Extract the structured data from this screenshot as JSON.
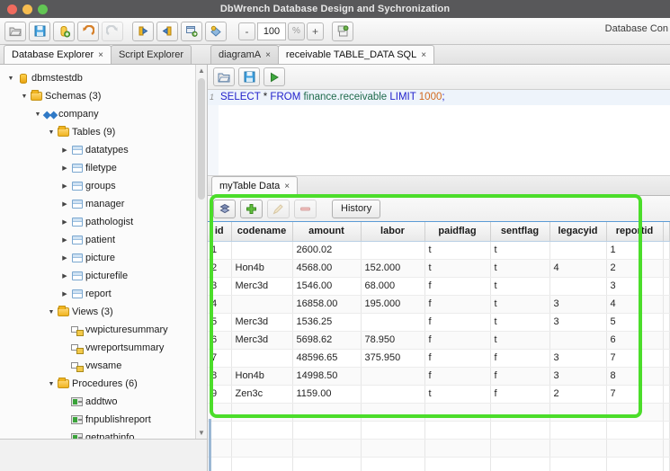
{
  "window": {
    "title": "DbWrench Database Design and Sychronization",
    "traffic_lights": [
      "close",
      "minimize",
      "maximize"
    ]
  },
  "toolbar": {
    "buttons": [
      {
        "name": "open-icon",
        "label": "Open"
      },
      {
        "name": "save-icon",
        "label": "Save"
      },
      {
        "name": "database-icon",
        "label": "New Database"
      },
      {
        "name": "undo-icon",
        "label": "Undo"
      },
      {
        "name": "redo-icon",
        "label": "Redo"
      },
      {
        "name": "forward-engineer-icon",
        "label": "Forward Engineer"
      },
      {
        "name": "reverse-engineer-icon",
        "label": "Reverse Engineer"
      },
      {
        "name": "compare-icon",
        "label": "Compare"
      },
      {
        "name": "sync-icon",
        "label": "Synchronize"
      }
    ],
    "zoom_minus": "-",
    "zoom_value": "100",
    "zoom_percent": "%",
    "zoom_plus": "+",
    "new_doc_label": "New Document",
    "database_connection_label": "Database Con"
  },
  "left_panel": {
    "tabs": [
      {
        "label": "Database Explorer",
        "close": "×",
        "active": true
      },
      {
        "label": "Script Explorer",
        "close": "",
        "active": false
      }
    ],
    "tree": [
      {
        "label": "dbmstestdb",
        "indent": 0,
        "arrow": "down",
        "icon": "database-icon"
      },
      {
        "label": "Schemas (3)",
        "indent": 1,
        "arrow": "down",
        "icon": "folder-icon"
      },
      {
        "label": "company",
        "indent": 2,
        "arrow": "down",
        "icon": "schema-icon"
      },
      {
        "label": "Tables (9)",
        "indent": 3,
        "arrow": "down",
        "icon": "folder-icon"
      },
      {
        "label": "datatypes",
        "indent": 4,
        "arrow": "right",
        "icon": "table-icon"
      },
      {
        "label": "filetype",
        "indent": 4,
        "arrow": "right",
        "icon": "table-icon"
      },
      {
        "label": "groups",
        "indent": 4,
        "arrow": "right",
        "icon": "table-icon"
      },
      {
        "label": "manager",
        "indent": 4,
        "arrow": "right",
        "icon": "table-icon"
      },
      {
        "label": "pathologist",
        "indent": 4,
        "arrow": "right",
        "icon": "table-icon"
      },
      {
        "label": "patient",
        "indent": 4,
        "arrow": "right",
        "icon": "table-icon"
      },
      {
        "label": "picture",
        "indent": 4,
        "arrow": "right",
        "icon": "table-icon"
      },
      {
        "label": "picturefile",
        "indent": 4,
        "arrow": "right",
        "icon": "table-icon"
      },
      {
        "label": "report",
        "indent": 4,
        "arrow": "right",
        "icon": "table-icon"
      },
      {
        "label": "Views (3)",
        "indent": 3,
        "arrow": "down",
        "icon": "folder-icon"
      },
      {
        "label": "vwpicturesummary",
        "indent": 4,
        "arrow": "none",
        "icon": "view-icon"
      },
      {
        "label": "vwreportsummary",
        "indent": 4,
        "arrow": "none",
        "icon": "view-icon"
      },
      {
        "label": "vwsame",
        "indent": 4,
        "arrow": "none",
        "icon": "view-icon"
      },
      {
        "label": "Procedures (6)",
        "indent": 3,
        "arrow": "down",
        "icon": "folder-icon"
      },
      {
        "label": "addtwo",
        "indent": 4,
        "arrow": "none",
        "icon": "procedure-icon"
      },
      {
        "label": "fnpublishreport",
        "indent": 4,
        "arrow": "none",
        "icon": "procedure-icon"
      },
      {
        "label": "getpathinfo",
        "indent": 4,
        "arrow": "none",
        "icon": "procedure-icon"
      }
    ]
  },
  "editor": {
    "tabs": [
      {
        "label": "diagramA",
        "close": "×",
        "active": false
      },
      {
        "label": "receivable TABLE_DATA SQL",
        "close": "×",
        "active": true
      }
    ],
    "toolbar_buttons": [
      {
        "name": "open-script-icon",
        "label": "Open Script"
      },
      {
        "name": "save-script-icon",
        "label": "Save Script"
      },
      {
        "name": "run-script-icon",
        "label": "Execute"
      }
    ],
    "line_number": "1",
    "sql_tokens": [
      {
        "text": "SELECT",
        "type": "kw"
      },
      {
        "text": " ",
        "type": "plain"
      },
      {
        "text": "*",
        "type": "star"
      },
      {
        "text": " ",
        "type": "plain"
      },
      {
        "text": "FROM",
        "type": "kw"
      },
      {
        "text": " ",
        "type": "plain"
      },
      {
        "text": "finance.receivable",
        "type": "ident"
      },
      {
        "text": " ",
        "type": "plain"
      },
      {
        "text": "LIMIT",
        "type": "kw"
      },
      {
        "text": " ",
        "type": "plain"
      },
      {
        "text": "1000",
        "type": "num"
      },
      {
        "text": ";",
        "type": "punc"
      }
    ],
    "sql_text": "SELECT * FROM finance.receivable LIMIT 1000;"
  },
  "data_panel": {
    "tabs": [
      {
        "label": "myTable Data",
        "close": "×",
        "active": true
      }
    ],
    "toolbar_buttons": [
      {
        "name": "refresh-data-icon",
        "label": "Refresh",
        "disabled": false
      },
      {
        "name": "add-row-icon",
        "label": "Add Row",
        "disabled": false
      },
      {
        "name": "edit-row-icon",
        "label": "Edit Row",
        "disabled": true
      },
      {
        "name": "delete-row-icon",
        "label": "Delete Row",
        "disabled": true
      }
    ],
    "history_label": "History",
    "columns": [
      "id",
      "codename",
      "amount",
      "labor",
      "paidflag",
      "sentflag",
      "legacyid",
      "reportid"
    ],
    "rows": [
      [
        "1",
        "",
        "2600.02",
        "",
        "t",
        "t",
        "",
        "1"
      ],
      [
        "2",
        "Hon4b",
        "4568.00",
        "152.000",
        "t",
        "t",
        "4",
        "2"
      ],
      [
        "3",
        "Merc3d",
        "1546.00",
        "68.000",
        "f",
        "t",
        "",
        "3"
      ],
      [
        "4",
        "",
        "16858.00",
        "195.000",
        "f",
        "t",
        "3",
        "4"
      ],
      [
        "5",
        "Merc3d",
        "1536.25",
        "",
        "f",
        "t",
        "3",
        "5"
      ],
      [
        "6",
        "Merc3d",
        "5698.62",
        "78.950",
        "f",
        "t",
        "",
        "6"
      ],
      [
        "7",
        "",
        "48596.65",
        "375.950",
        "f",
        "f",
        "3",
        "7"
      ],
      [
        "8",
        "Hon4b",
        "14998.50",
        "",
        "f",
        "f",
        "3",
        "8"
      ],
      [
        "9",
        "Zen3c",
        "1159.00",
        "",
        "t",
        "f",
        "2",
        "7"
      ]
    ],
    "empty_row_count": 4
  },
  "colors": {
    "titlebar": "#58585a",
    "highlight_border": "#4bdd2a",
    "header_underline": "#5b9bd5",
    "keyword": "#2222cc",
    "identifier": "#1f6b4c",
    "number": "#d2691e"
  }
}
